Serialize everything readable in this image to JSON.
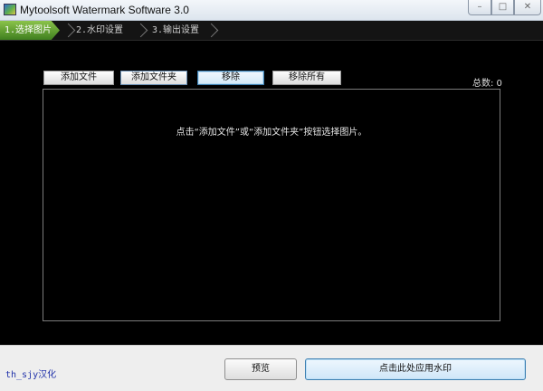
{
  "window": {
    "title": "Mytoolsoft Watermark Software 3.0",
    "controls": {
      "minimize": "–",
      "maximize": "□",
      "close": "✕"
    }
  },
  "steps": [
    {
      "label": "1.选择图片",
      "active": true
    },
    {
      "label": "2.水印设置",
      "active": false
    },
    {
      "label": "3.输出设置",
      "active": false
    }
  ],
  "toolbar": {
    "add_file": "添加文件",
    "add_folder": "添加文件夹",
    "remove": "移除",
    "remove_all": "移除所有",
    "total": "总数: 0"
  },
  "list": {
    "hint": "点击“添加文件”或“添加文件夹”按钮选择图片。"
  },
  "footer": {
    "credit": "th_sjy汉化",
    "preview": "预览",
    "apply": "点击此处应用水印"
  },
  "colors": {
    "active_step": "#6aab32",
    "background": "#000000",
    "credit_text": "#2233aa",
    "primary_button_border": "#3c7fb1"
  }
}
